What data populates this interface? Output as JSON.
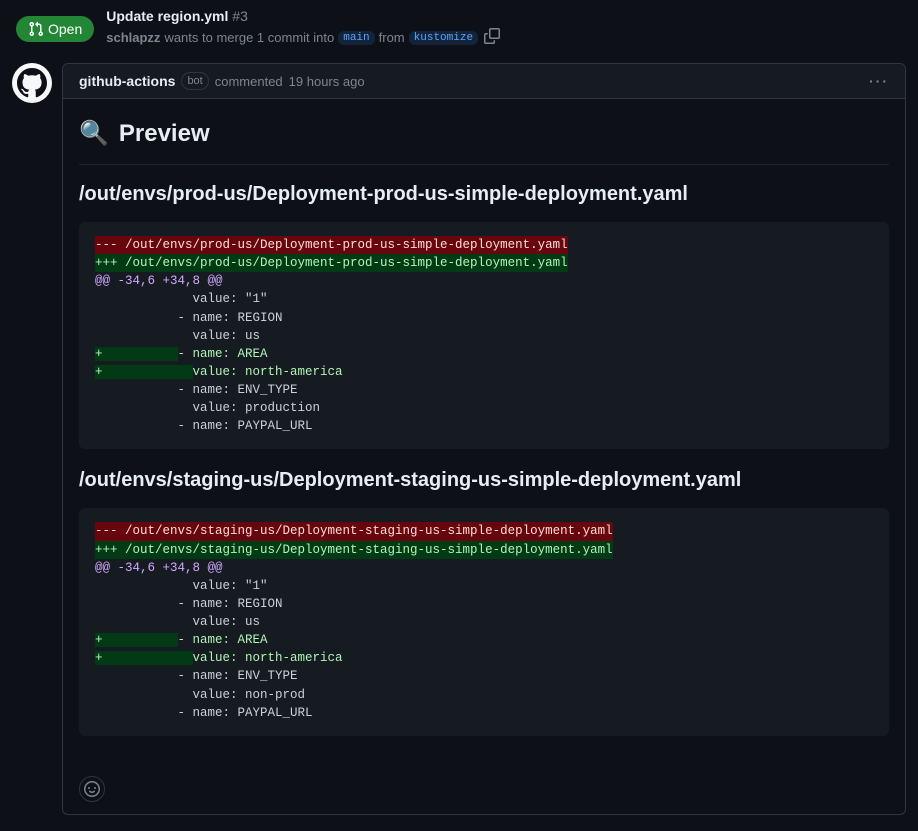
{
  "header": {
    "open_label": "Open",
    "pr_title": "Update region.yml",
    "pr_number": "#3",
    "author": "schlapzz",
    "merge_text_1": "wants to merge 1 commit into",
    "base_branch": "main",
    "merge_text_2": "from",
    "head_branch": "kustomize"
  },
  "comment": {
    "author": "github-actions",
    "bot_label": "bot",
    "time_prefix": "commented",
    "time": "19 hours ago",
    "preview_icon": "🔍",
    "preview_title": "Preview",
    "files": [
      {
        "heading": "/out/envs/prod-us/Deployment-prod-us-simple-deployment.yaml",
        "diff": {
          "del": "--- /out/envs/prod-us/Deployment-prod-us-simple-deployment.yaml",
          "add": "+++ /out/envs/prod-us/Deployment-prod-us-simple-deployment.yaml",
          "hunk": "@@ -34,6 +34,8 @@",
          "ctx1": "             value: \"1\"",
          "ctx2": "           - name: REGION",
          "ctx3": "             value: us",
          "add1_prefix": "+          ",
          "add1_text": "- name: AREA",
          "add2_prefix": "+            ",
          "add2_text": "value: north-america",
          "ctx4": "           - name: ENV_TYPE",
          "ctx5": "             value: production",
          "ctx6": "           - name: PAYPAL_URL"
        }
      },
      {
        "heading": "/out/envs/staging-us/Deployment-staging-us-simple-deployment.yaml",
        "diff": {
          "del": "--- /out/envs/staging-us/Deployment-staging-us-simple-deployment.yaml",
          "add": "+++ /out/envs/staging-us/Deployment-staging-us-simple-deployment.yaml",
          "hunk": "@@ -34,6 +34,8 @@",
          "ctx1": "             value: \"1\"",
          "ctx2": "           - name: REGION",
          "ctx3": "             value: us",
          "add1_prefix": "+          ",
          "add1_text": "- name: AREA",
          "add2_prefix": "+            ",
          "add2_text": "value: north-america",
          "ctx4": "           - name: ENV_TYPE",
          "ctx5": "             value: non-prod",
          "ctx6": "           - name: PAYPAL_URL"
        }
      }
    ]
  }
}
